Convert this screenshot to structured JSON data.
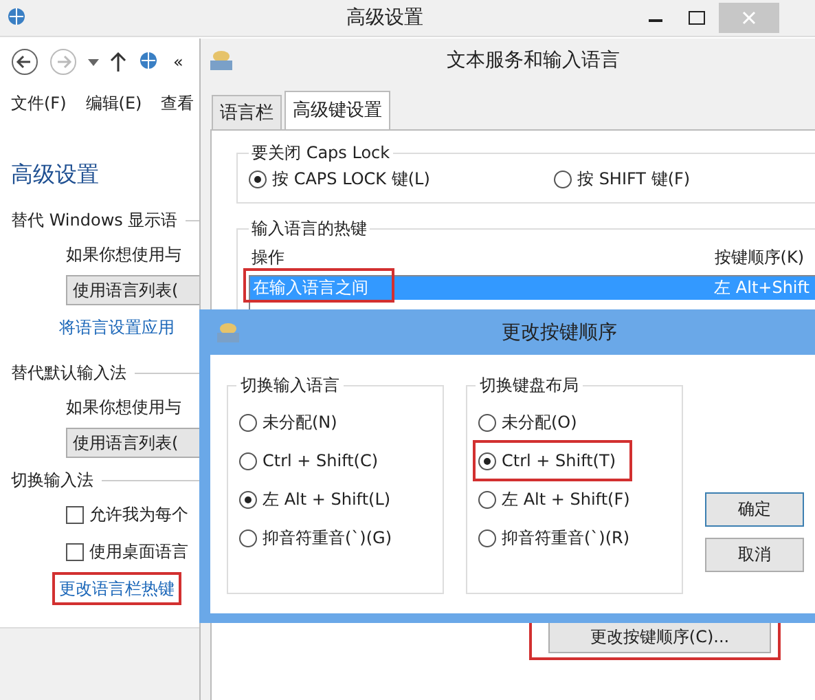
{
  "main_window": {
    "title": "高级设置",
    "nav": {
      "breadcrumb": "«"
    },
    "menu": [
      "文件(F)",
      "编辑(E)",
      "查看"
    ],
    "heading": "高级设置",
    "sections": [
      {
        "title": "替代 Windows 显示语",
        "description": "如果你想使用与",
        "button": "使用语言列表(",
        "link": "将语言设置应用"
      },
      {
        "title": "替代默认输入法",
        "description": "如果你想使用与",
        "button": "使用语言列表("
      },
      {
        "title": "切换输入法",
        "checkboxes": [
          {
            "label": "允许我为每个",
            "checked": false
          },
          {
            "label": "使用桌面语言",
            "checked": false
          }
        ],
        "link": "更改语言栏热键",
        "highlighted": true
      }
    ]
  },
  "text_services_dialog": {
    "title": "文本服务和输入语言",
    "tabs": [
      {
        "label": "语言栏",
        "selected": false
      },
      {
        "label": "高级键设置",
        "selected": true
      }
    ],
    "caps_lock_group": {
      "title": "要关闭 Caps Lock",
      "options": [
        {
          "label": "按 CAPS LOCK 键(L)",
          "selected": true
        },
        {
          "label": "按 SHIFT 键(F)",
          "selected": false
        }
      ]
    },
    "hotkeys_group": {
      "title": "输入语言的热键",
      "columns": [
        "操作",
        "按键顺序(K)"
      ],
      "rows": [
        {
          "action": "在输入语言之间",
          "keys": "左 Alt+Shift",
          "selected": true,
          "highlighted": true
        }
      ]
    },
    "button": {
      "label": "更改按键顺序(C)...",
      "highlighted": true
    }
  },
  "key_sequence_dialog": {
    "title": "更改按键顺序",
    "groups": [
      {
        "title": "切换输入语言",
        "options": [
          {
            "label": "未分配(N)",
            "selected": false,
            "highlighted": false
          },
          {
            "label": "Ctrl + Shift(C)",
            "selected": false,
            "highlighted": false
          },
          {
            "label": "左 Alt + Shift(L)",
            "selected": true,
            "highlighted": false
          },
          {
            "label": "抑音符重音(`)(G)",
            "selected": false,
            "highlighted": false
          }
        ]
      },
      {
        "title": "切换键盘布局",
        "options": [
          {
            "label": "未分配(O)",
            "selected": false,
            "highlighted": false
          },
          {
            "label": "Ctrl + Shift(T)",
            "selected": true,
            "highlighted": true
          },
          {
            "label": "左 Alt + Shift(F)",
            "selected": false,
            "highlighted": false
          },
          {
            "label": "抑音符重音(`)(R)",
            "selected": false,
            "highlighted": false
          }
        ]
      }
    ],
    "buttons": [
      "确定",
      "取消"
    ]
  }
}
